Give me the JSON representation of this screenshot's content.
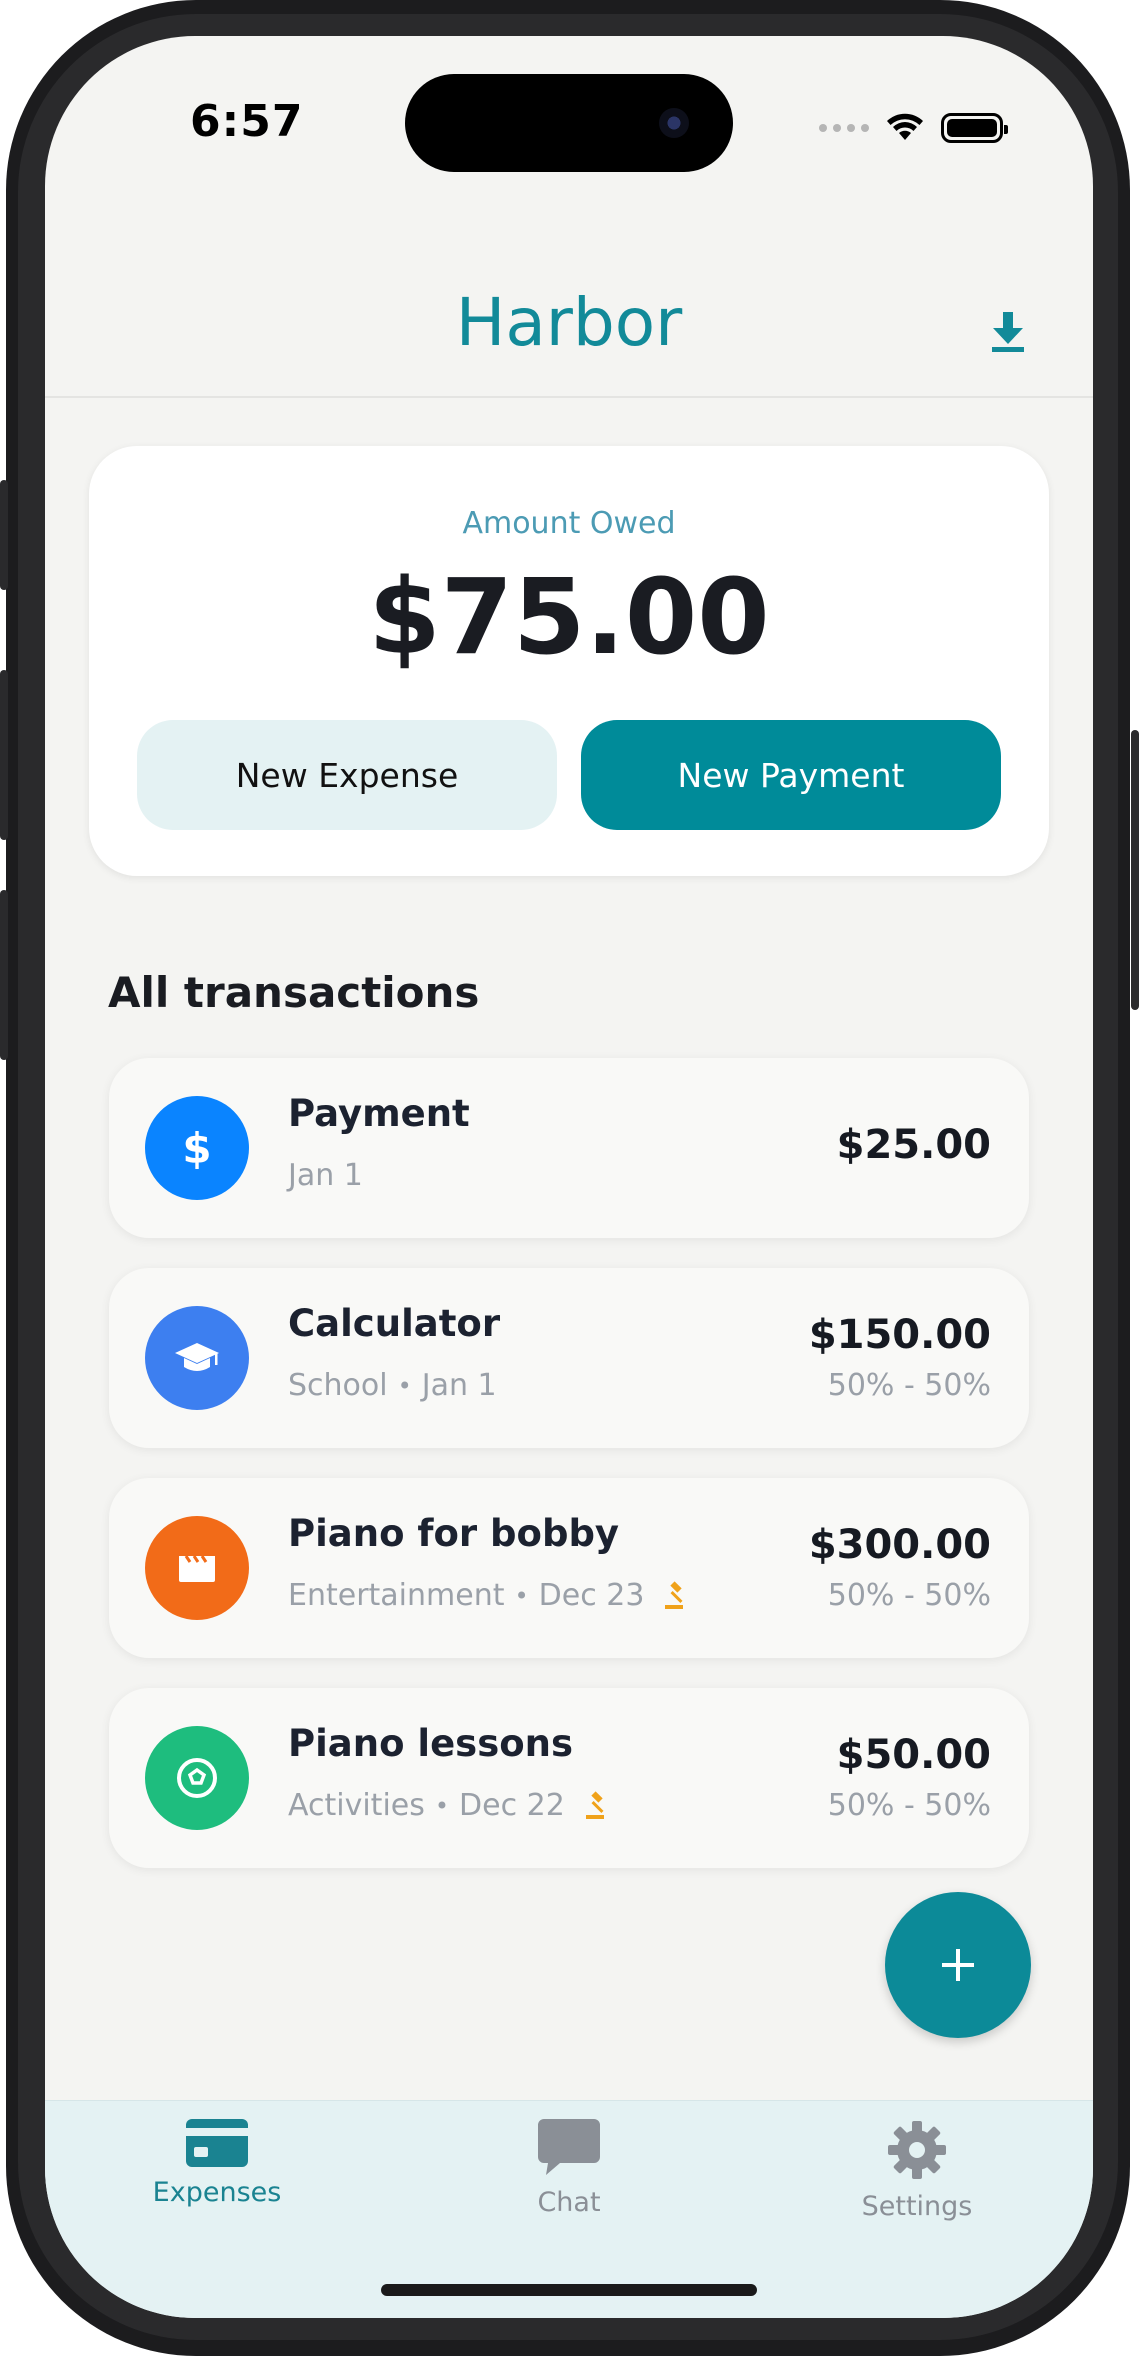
{
  "status_bar": {
    "time": "6:57"
  },
  "header": {
    "title": "Harbor",
    "download_icon": "download-icon"
  },
  "summary": {
    "label": "Amount Owed",
    "amount": "$75.00",
    "new_expense_label": "New Expense",
    "new_payment_label": "New Payment"
  },
  "transactions": {
    "title": "All transactions",
    "items": [
      {
        "name": "Payment",
        "sub": "Jan 1",
        "category": "",
        "amount": "$25.00",
        "split": "",
        "icon": "dollar-icon",
        "color": "#0a84ff",
        "flagged": false
      },
      {
        "name": "Calculator",
        "category": "School",
        "date": "Jan 1",
        "amount": "$150.00",
        "split": "50% - 50%",
        "icon": "graduation-cap-icon",
        "color": "#3d7ff0",
        "flagged": false
      },
      {
        "name": "Piano for bobby",
        "category": "Entertainment",
        "date": "Dec 23",
        "amount": "$300.00",
        "split": "50% - 50%",
        "icon": "film-clapper-icon",
        "color": "#f26b18",
        "flagged": true
      },
      {
        "name": "Piano lessons",
        "category": "Activities",
        "date": "Dec 22",
        "amount": "$50.00",
        "split": "50% - 50%",
        "icon": "soccer-ball-icon",
        "color": "#1ebd7e",
        "flagged": true
      }
    ]
  },
  "fab": {
    "icon": "plus-icon"
  },
  "tabbar": {
    "active": "Expenses",
    "tabs": [
      {
        "label": "Expenses",
        "icon": "credit-card-icon"
      },
      {
        "label": "Chat",
        "icon": "chat-bubble-icon"
      },
      {
        "label": "Settings",
        "icon": "gear-icon"
      }
    ]
  },
  "colors": {
    "accent": "#008b99",
    "title": "#128a99",
    "tab_active": "#1a8391",
    "tab_inactive": "#8a8f96",
    "flag": "#f0a21a"
  }
}
